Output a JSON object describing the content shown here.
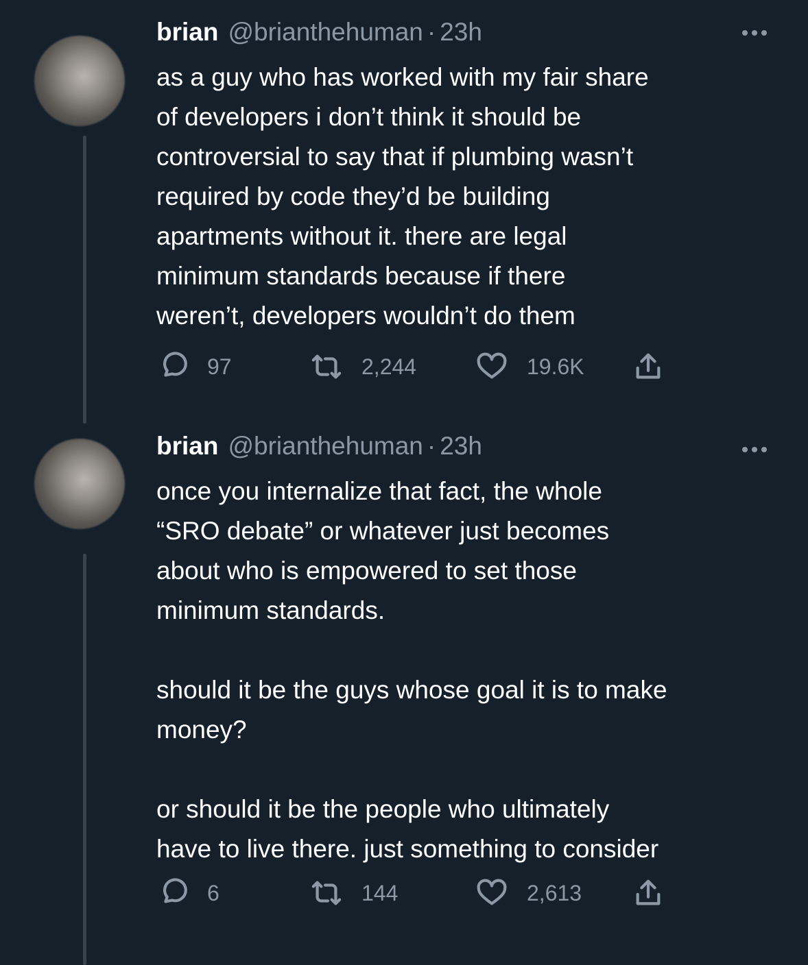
{
  "tweets": [
    {
      "name": "brian",
      "handle": "@brianthehuman",
      "separator": "·",
      "time": "23h",
      "text": "as a guy who has worked with my fair share\nof developers i don’t think it should be\ncontroversial to say that if plumbing wasn’t\nrequired by code they’d be building\napartments without it. there are legal\nminimum standards because if there\nweren’t, developers wouldn’t do them",
      "reply_count": "97",
      "retweet_count": "2,244",
      "like_count": "19.6K"
    },
    {
      "name": "brian",
      "handle": "@brianthehuman",
      "separator": "·",
      "time": "23h",
      "text": "once you internalize that fact, the whole\n“SRO debate” or whatever just becomes\nabout who is empowered to set those\nminimum standards.\n\nshould it be the guys whose goal it is to make\nmoney?\n\nor should it be the people who ultimately\nhave to live there. just something to consider",
      "reply_count": "6",
      "retweet_count": "144",
      "like_count": "2,613"
    }
  ],
  "icons": {
    "reply": "reply-icon",
    "retweet": "retweet-icon",
    "like": "heart-icon",
    "share": "share-icon",
    "more": "more-icon"
  },
  "colors": {
    "background": "#15202b",
    "text": "#ffffff",
    "secondary": "#8b98a5",
    "thread_line": "#38444d"
  }
}
